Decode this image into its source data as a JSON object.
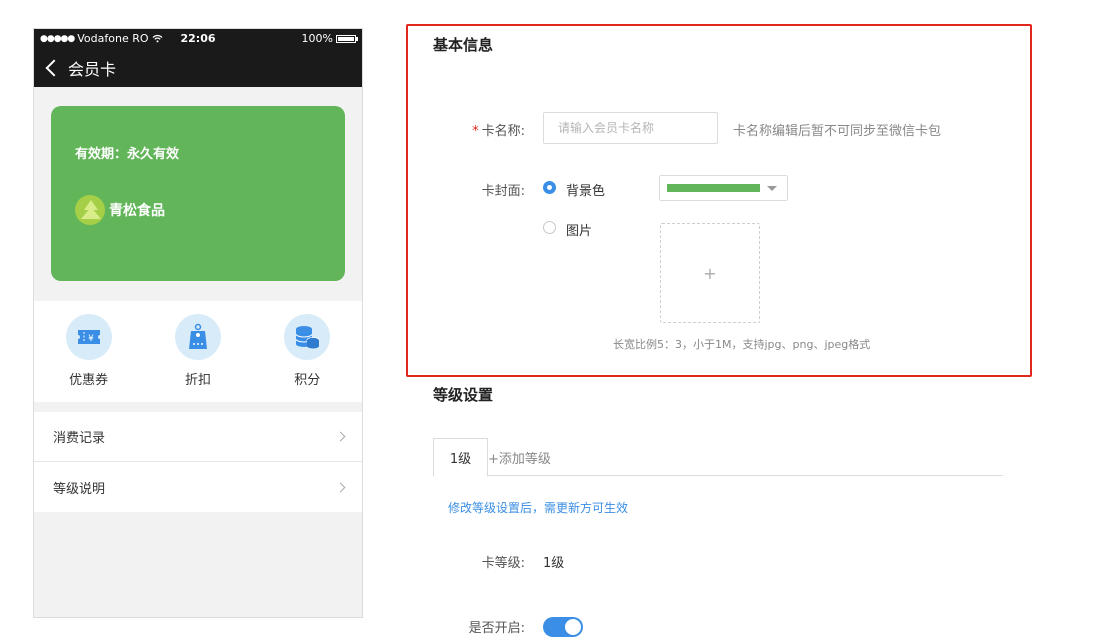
{
  "phone": {
    "status": {
      "carrier": "Vodafone RO",
      "time": "22:06",
      "battery": "100%"
    },
    "nav_title": "会员卡",
    "card": {
      "validity": "有效期：永久有效",
      "brand": "青松食品",
      "color": "#63b55a"
    },
    "features": [
      {
        "label": "优惠券",
        "icon": "coupon-icon"
      },
      {
        "label": "折扣",
        "icon": "discount-tag-icon"
      },
      {
        "label": "积分",
        "icon": "points-coins-icon"
      }
    ],
    "list": [
      {
        "label": "消费记录"
      },
      {
        "label": "等级说明"
      }
    ]
  },
  "basic": {
    "title": "基本信息",
    "name_label": "卡名称:",
    "name_required": "*",
    "name_placeholder": "请输入会员卡名称",
    "name_hint": "卡名称编辑后暂不可同步至微信卡包",
    "cover_label": "卡封面:",
    "option_bg": "背景色",
    "option_image": "图片",
    "selected_color": "#63b55a",
    "upload_plus": "+",
    "upload_hint": "长宽比例5：3，小于1M，支持jpg、png、jpeg格式"
  },
  "level": {
    "title": "等级设置",
    "tabs": [
      {
        "label": "1级"
      }
    ],
    "add_tab": "+添加等级",
    "notice": "修改等级设置后，需更新方可生效",
    "level_label": "卡等级:",
    "level_value": "1级",
    "enable_label": "是否开启:",
    "enabled": true
  },
  "colors": {
    "accent": "#3a8ee6",
    "highlight": "#e1261c",
    "card_green": "#63b55a"
  }
}
